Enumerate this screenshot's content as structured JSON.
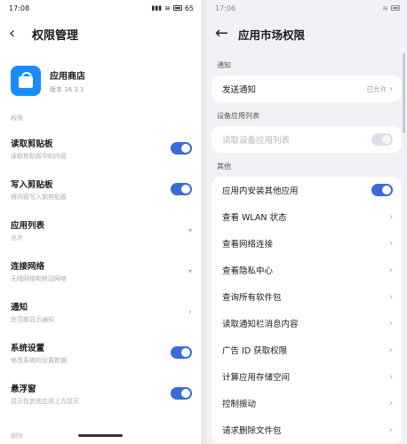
{
  "left": {
    "status": {
      "time": "17:08",
      "icons_text": "ᵢ ≋ ▭",
      "battery": "65"
    },
    "title": "权限管理",
    "app": {
      "name": "应用商店",
      "version": "版本 16.3.1"
    },
    "section": "权限",
    "rows": [
      {
        "main": "读取剪贴板",
        "sub": "读取剪贴板中的内容",
        "control": "toggle"
      },
      {
        "main": "写入剪贴板",
        "sub": "将内容写入到剪贴板",
        "control": "toggle"
      },
      {
        "main": "应用列表",
        "sub": "允许",
        "control": "dropdown"
      },
      {
        "main": "连接网络",
        "sub": "无线网络和移动网络",
        "control": "dropdown"
      },
      {
        "main": "通知",
        "sub": "在顶部显示通知",
        "control": "arrow"
      },
      {
        "main": "系统设置",
        "sub": "修改系统的设置数据",
        "control": "toggle"
      },
      {
        "main": "悬浮窗",
        "sub": "显示在其他应用上方显示",
        "control": "toggle"
      }
    ],
    "bottom_hint": "删除"
  },
  "right": {
    "status": {
      "time": "17:06"
    },
    "title": "应用市场权限",
    "sections": [
      {
        "label": "通知",
        "rows": [
          {
            "main": "发送通知",
            "value": "已允许",
            "control": "arrow"
          }
        ]
      },
      {
        "label": "设备应用列表",
        "rows": [
          {
            "main": "读取设备应用列表",
            "control": "toggle-disabled",
            "dim": true
          }
        ]
      },
      {
        "label": "其他",
        "rows": [
          {
            "main": "应用内安装其他应用",
            "control": "toggle"
          },
          {
            "main": "查看 WLAN 状态",
            "control": "arrow"
          },
          {
            "main": "查看网络连接",
            "control": "arrow"
          },
          {
            "main": "查看隐私中心",
            "control": "arrow"
          },
          {
            "main": "查询所有软件包",
            "control": "arrow"
          },
          {
            "main": "读取通知栏消息内容",
            "control": "arrow"
          },
          {
            "main": "广告 ID 获取权限",
            "control": "arrow"
          },
          {
            "main": "计算应用存储空间",
            "control": "arrow"
          },
          {
            "main": "控制振动",
            "control": "arrow"
          },
          {
            "main": "请求删除文件包",
            "control": "arrow"
          }
        ]
      }
    ]
  },
  "colors": {
    "accent": "#3b6bd8",
    "app_icon": "#1a8cff"
  }
}
